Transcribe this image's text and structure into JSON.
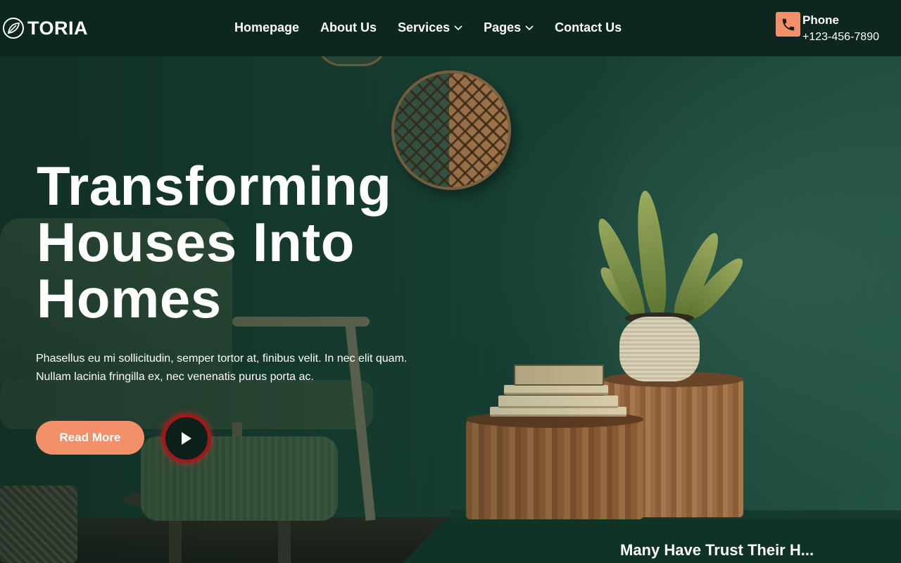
{
  "brand": {
    "name": "TORIA",
    "logo_icon": "leaf-circle-icon"
  },
  "nav": {
    "items": [
      {
        "label": "Homepage",
        "has_dropdown": false
      },
      {
        "label": "About Us",
        "has_dropdown": false
      },
      {
        "label": "Services",
        "has_dropdown": true
      },
      {
        "label": "Pages",
        "has_dropdown": true
      },
      {
        "label": "Contact Us",
        "has_dropdown": false
      }
    ]
  },
  "contact": {
    "label": "Phone",
    "number": "+123-456-7890",
    "icon": "phone-icon"
  },
  "hero": {
    "title_line1": "Transforming",
    "title_line2": "Houses Into",
    "title_line3": "Homes",
    "description": "Phasellus eu mi sollicitudin, semper tortor at, finibus velit. In nec elit quam. Nullam lacinia fringilla ex, nec venenatis purus porta ac.",
    "cta_label": "Read More",
    "play_icon": "play-icon"
  },
  "trust": {
    "title": "Many Have Trust Their H..."
  },
  "colors": {
    "header_bg": "#0d2620",
    "accent": "#f3906a",
    "hero_green": "#1c4737",
    "panel_bg": "#0f3327",
    "play_ring": "#9c1a1a"
  }
}
